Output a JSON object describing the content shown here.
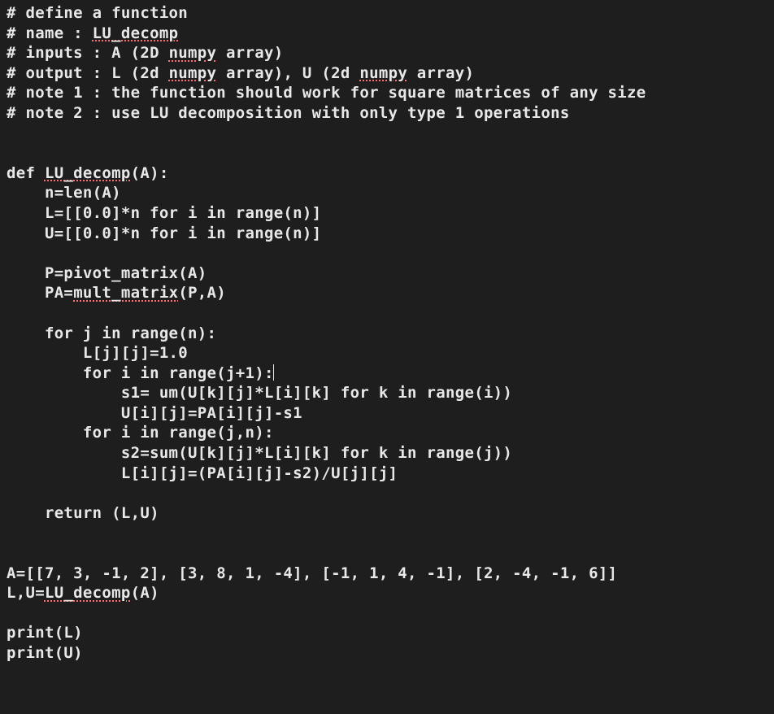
{
  "code": {
    "lines": [
      {
        "segments": [
          {
            "t": "# define a function"
          }
        ]
      },
      {
        "segments": [
          {
            "t": "# name : "
          },
          {
            "t": "LU_decomp",
            "err": true
          }
        ]
      },
      {
        "segments": [
          {
            "t": "# inputs : A (2D "
          },
          {
            "t": "numpy",
            "err": true
          },
          {
            "t": " array)"
          }
        ]
      },
      {
        "segments": [
          {
            "t": "# output : L (2d "
          },
          {
            "t": "numpy",
            "err": true
          },
          {
            "t": " array), U (2d "
          },
          {
            "t": "numpy",
            "err": true
          },
          {
            "t": " array)"
          }
        ]
      },
      {
        "segments": [
          {
            "t": "# note 1 : the function should work for square matrices of any size"
          }
        ]
      },
      {
        "segments": [
          {
            "t": "# note 2 : use LU decomposition with only type 1 operations"
          }
        ]
      },
      {
        "segments": [
          {
            "t": ""
          }
        ]
      },
      {
        "segments": [
          {
            "t": ""
          }
        ]
      },
      {
        "segments": [
          {
            "t": "def "
          },
          {
            "t": "LU_decomp",
            "err": true
          },
          {
            "t": "(A):"
          }
        ]
      },
      {
        "segments": [
          {
            "t": "    n=len(A)"
          }
        ]
      },
      {
        "segments": [
          {
            "t": "    L=[[0.0]*n for i in range(n)]"
          }
        ]
      },
      {
        "segments": [
          {
            "t": "    U=[[0.0]*n for i in range(n)]"
          }
        ]
      },
      {
        "segments": [
          {
            "t": ""
          }
        ]
      },
      {
        "segments": [
          {
            "t": "    P=pivot_matrix(A)"
          }
        ]
      },
      {
        "segments": [
          {
            "t": "    PA="
          },
          {
            "t": "mult_matrix",
            "err": true
          },
          {
            "t": "(P,A)"
          }
        ]
      },
      {
        "segments": [
          {
            "t": ""
          }
        ]
      },
      {
        "segments": [
          {
            "t": "    for j in range(n):"
          }
        ]
      },
      {
        "segments": [
          {
            "t": "        L[j][j]=1.0"
          }
        ]
      },
      {
        "segments": [
          {
            "t": "        for i in range(j+1):"
          },
          {
            "cursor": true
          }
        ]
      },
      {
        "segments": [
          {
            "t": "            s1= um(U[k][j]*L[i][k] for k in range(i))"
          }
        ]
      },
      {
        "segments": [
          {
            "t": "            U[i][j]=PA[i][j]-s1"
          }
        ]
      },
      {
        "segments": [
          {
            "t": "        for i in range(j,n):"
          }
        ]
      },
      {
        "segments": [
          {
            "t": "            s2=sum(U[k][j]*L[i][k] for k in range(j))"
          }
        ]
      },
      {
        "segments": [
          {
            "t": "            L[i][j]=(PA[i][j]-s2)/U[j][j]"
          }
        ]
      },
      {
        "segments": [
          {
            "t": ""
          }
        ]
      },
      {
        "segments": [
          {
            "t": "    return (L,U)"
          }
        ]
      },
      {
        "segments": [
          {
            "t": ""
          }
        ]
      },
      {
        "segments": [
          {
            "t": ""
          }
        ]
      },
      {
        "segments": [
          {
            "t": "A=[[7, 3, -1, 2], [3, 8, 1, -4], [-1, 1, 4, -1], [2, -4, -1, 6]]"
          }
        ]
      },
      {
        "segments": [
          {
            "t": "L,U="
          },
          {
            "t": "LU_decomp",
            "err": true
          },
          {
            "t": "(A)"
          }
        ]
      },
      {
        "segments": [
          {
            "t": ""
          }
        ]
      },
      {
        "segments": [
          {
            "t": "print(L)"
          }
        ]
      },
      {
        "segments": [
          {
            "t": "print(U)"
          }
        ]
      }
    ]
  }
}
